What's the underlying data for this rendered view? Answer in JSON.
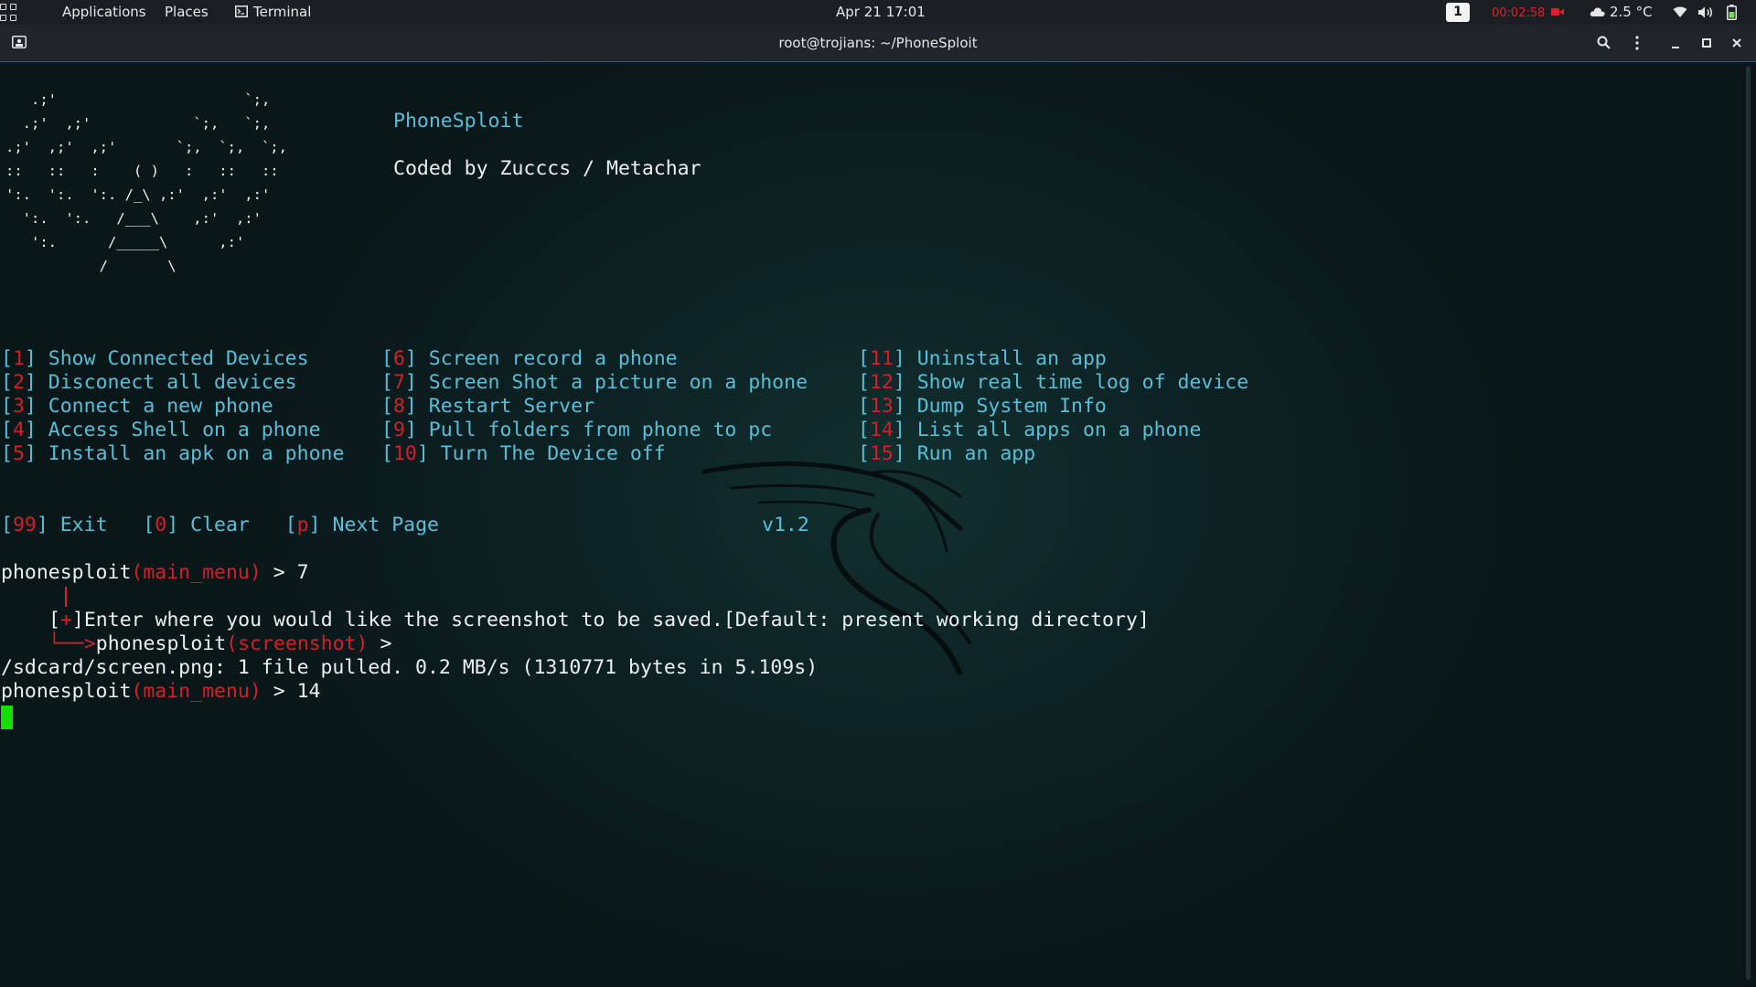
{
  "topbar": {
    "applications": "Applications",
    "places": "Places",
    "terminal": "Terminal",
    "datetime": "Apr 21  17:01",
    "workspace": "1",
    "recording_time": "00:02:58",
    "temperature": "2.5 °C"
  },
  "window": {
    "title": "root@trojians: ~/PhoneSploit"
  },
  "banner": {
    "ascii_art": "   .;'                      `;,\n  .;'  ,;'            `;,   `;,\n.;'  ,;'  ,;'       `;,  `;,  `;,\n::   ::   :    ( )   :   ::   ::\n':.  ':.  ':. /_\\ ,:'  ,:'  ,:'\n  ':.  ':.   /___\\    ,:'  ,:'\n   ':.      /_____\\      ,:'\n           /       \\",
    "name": "PhoneSploit",
    "credit": "Coded by Zucccs / Metachar"
  },
  "menu": {
    "col1": [
      {
        "num": "1",
        "label": "Show Connected Devices"
      },
      {
        "num": "2",
        "label": "Disconect all devices"
      },
      {
        "num": "3",
        "label": "Connect a new phone"
      },
      {
        "num": "4",
        "label": "Access Shell on a phone"
      },
      {
        "num": "5",
        "label": "Install an apk on a phone"
      }
    ],
    "col2": [
      {
        "num": "6",
        "label": "Screen record a phone"
      },
      {
        "num": "7",
        "label": "Screen Shot a picture on a phone"
      },
      {
        "num": "8",
        "label": "Restart Server"
      },
      {
        "num": "9",
        "label": "Pull folders from phone to pc"
      },
      {
        "num": "10",
        "label": "Turn The Device off"
      }
    ],
    "col3": [
      {
        "num": "11",
        "label": "Uninstall an app"
      },
      {
        "num": "12",
        "label": "Show real time log of device"
      },
      {
        "num": "13",
        "label": "Dump System Info"
      },
      {
        "num": "14",
        "label": "List all apps on a phone"
      },
      {
        "num": "15",
        "label": "Run an app"
      }
    ],
    "footer": {
      "exit_num": "99",
      "exit_label": "Exit",
      "clear_num": "0",
      "clear_label": "Clear",
      "next_num": "p",
      "next_label": "Next Page",
      "version": "v1.2"
    }
  },
  "session": {
    "prompt_name": "phonesploit",
    "main_menu_ctx": "(main_menu)",
    "cmd1": " > 7",
    "plus": "+",
    "save_prompt": "Enter where you would like the screenshot to be saved.[Default: present working directory]",
    "screenshot_ctx": "(screenshot)",
    "arrow_tail": " >",
    "pull_result": "/sdcard/screen.png: 1 file pulled. 0.2 MB/s (1310771 bytes in 5.109s)",
    "cmd2": " > 14"
  },
  "colors": {
    "accent_teal": "#58bfd9",
    "accent_red": "#d2202a",
    "cursor_green": "#14e000"
  }
}
